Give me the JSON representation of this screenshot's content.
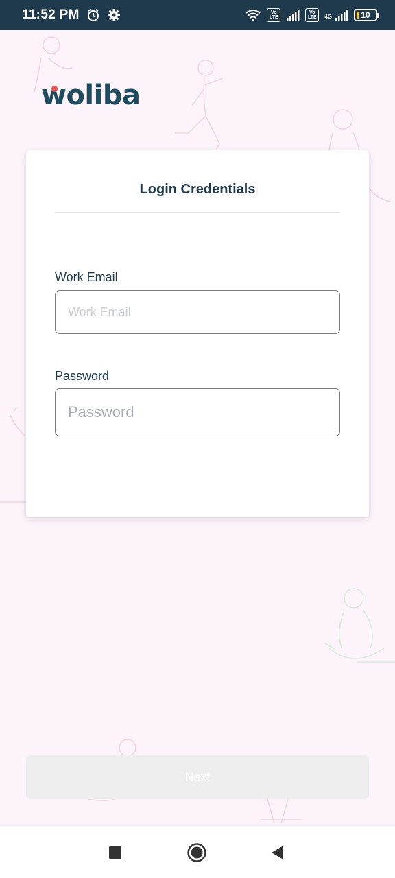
{
  "status_bar": {
    "time": "11:52 PM",
    "battery_level": "10",
    "network": "4G",
    "volte_line1": "Vo",
    "volte_line2": "LTE",
    "icons": [
      "alarm-icon",
      "settings-icon",
      "wifi-icon",
      "volte-icon",
      "signal-icon",
      "battery-icon"
    ]
  },
  "logo": {
    "first_letter": "w",
    "rest": "oliba",
    "accent_color": "#e8554d",
    "brand_color": "#1f4b5e"
  },
  "card": {
    "title": "Login Credentials"
  },
  "form": {
    "email_label": "Work Email",
    "email_placeholder": "Work Email",
    "email_value": "",
    "password_label": "Password",
    "password_placeholder": "Password",
    "password_value": ""
  },
  "actions": {
    "next_label": "Next"
  },
  "navigation": {
    "icons": [
      "recents-square-icon",
      "home-circle-icon",
      "back-triangle-icon"
    ]
  }
}
